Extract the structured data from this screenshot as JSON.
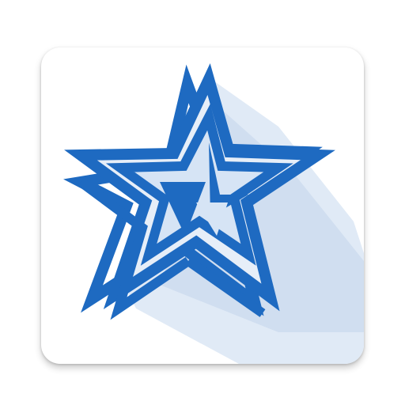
{
  "app_icon": {
    "icon_name": "impossible-star-icon",
    "colors": {
      "tile_background": "#ffffff",
      "star_stroke": "#1e6ac1",
      "star_inner_fill": "#d6e4f5",
      "long_shadow": "#c9d9ee"
    }
  }
}
